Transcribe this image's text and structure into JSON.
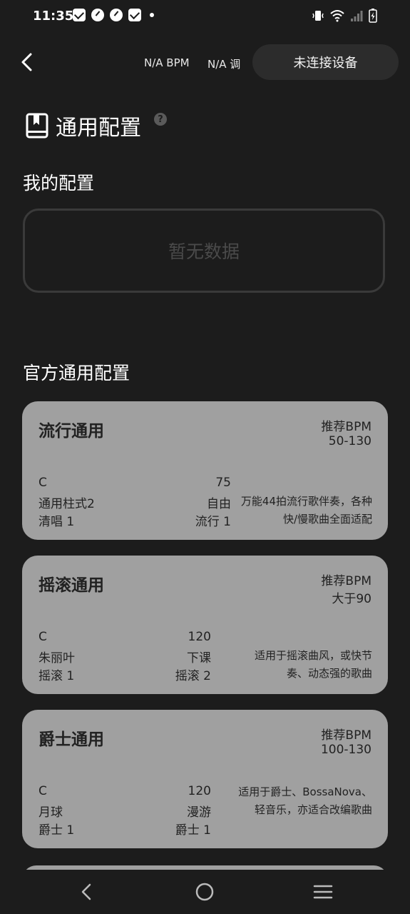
{
  "status_bar": {
    "time": "11:35"
  },
  "header": {
    "bpm": "N/A BPM",
    "key": "N/A 调",
    "device_button": "未连接设备"
  },
  "page": {
    "title": "通用配置",
    "help": "?"
  },
  "my_config": {
    "heading": "我的配置",
    "empty_text": "暂无数据"
  },
  "official": {
    "heading": "官方通用配置",
    "cards": [
      {
        "name": "流行通用",
        "bpm_title": "推荐BPM",
        "bpm_range": "50-130",
        "key": "C",
        "tempo": "75",
        "rhythm": "通用柱式2",
        "mode": "自由",
        "left_pattern": "清唱 1",
        "right_pattern": "流行 1",
        "desc": "万能44拍流行歌伴奏，各种快/慢歌曲全面适配"
      },
      {
        "name": "摇滚通用",
        "bpm_title": "推荐BPM",
        "bpm_range": "大于90",
        "key": "C",
        "tempo": "120",
        "rhythm": "朱丽叶",
        "mode": "下课",
        "left_pattern": "摇滚 1",
        "right_pattern": "摇滚 2",
        "desc": "适用于摇滚曲风，或快节奏、动态强的歌曲"
      },
      {
        "name": "爵士通用",
        "bpm_title": "推荐BPM",
        "bpm_range": "100-130",
        "key": "C",
        "tempo": "120",
        "rhythm": "月球",
        "mode": "漫游",
        "left_pattern": "爵士 1",
        "right_pattern": "爵士 1",
        "desc": "适用于爵士、BossaNova、轻音乐，亦适合改编歌曲"
      }
    ]
  },
  "colors": {
    "background": "#1c1c1c",
    "card": "#a0a0a0",
    "device_button": "#2c2c2c"
  }
}
